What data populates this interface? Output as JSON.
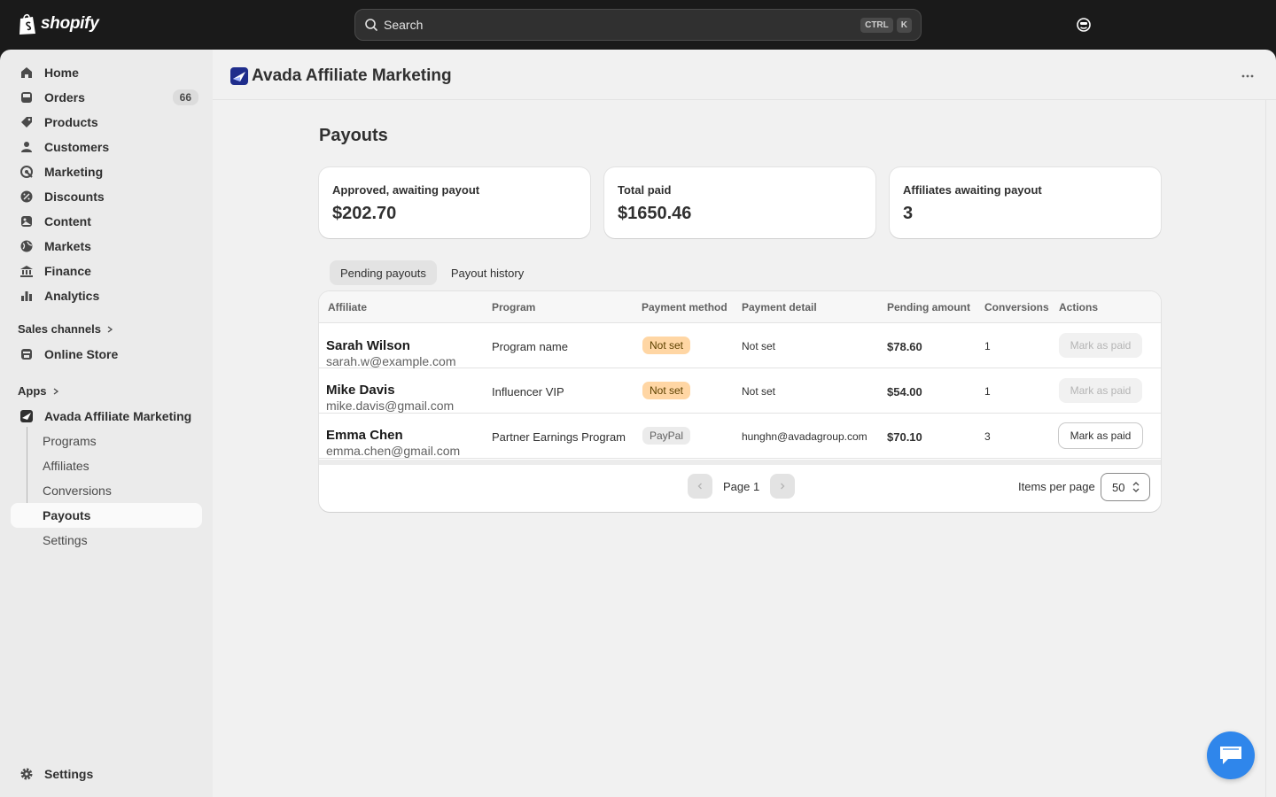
{
  "topbar": {
    "brand": "shopify",
    "search_placeholder": "Search",
    "shortcut_keys": [
      "CTRL",
      "K"
    ]
  },
  "sidebar": {
    "items": [
      {
        "label": "Home",
        "icon": "home-icon"
      },
      {
        "label": "Orders",
        "icon": "inbox-icon",
        "badge": "66"
      },
      {
        "label": "Products",
        "icon": "tag-icon"
      },
      {
        "label": "Customers",
        "icon": "person-icon"
      },
      {
        "label": "Marketing",
        "icon": "target-icon"
      },
      {
        "label": "Discounts",
        "icon": "discount-icon"
      },
      {
        "label": "Content",
        "icon": "content-icon"
      },
      {
        "label": "Markets",
        "icon": "globe-icon"
      },
      {
        "label": "Finance",
        "icon": "bank-icon"
      },
      {
        "label": "Analytics",
        "icon": "bar-chart-icon"
      }
    ],
    "sales_channels_label": "Sales channels",
    "online_store_label": "Online Store",
    "apps_label": "Apps",
    "app_label": "Avada Affiliate Marketing",
    "app_subitems": [
      "Programs",
      "Affiliates",
      "Conversions",
      "Payouts",
      "Settings"
    ],
    "active_subitem": "Payouts",
    "settings_label": "Settings"
  },
  "app": {
    "title": "Avada Affiliate Marketing"
  },
  "page": {
    "title": "Payouts",
    "stats": [
      {
        "label": "Approved, awaiting payout",
        "value": "$202.70"
      },
      {
        "label": "Total paid",
        "value": "$1650.46"
      },
      {
        "label": "Affiliates awaiting payout",
        "value": "3"
      }
    ],
    "tabs": [
      {
        "label": "Pending payouts",
        "active": true
      },
      {
        "label": "Payout history",
        "active": false
      }
    ],
    "table": {
      "columns": [
        "Affiliate",
        "Program",
        "Payment method",
        "Payment detail",
        "Pending amount",
        "Conversions",
        "Actions"
      ],
      "rows": [
        {
          "name": "Sarah Wilson",
          "email": "sarah.w@example.com",
          "program": "Program name",
          "method": "Not set",
          "method_style": "warn",
          "detail": "Not set",
          "amount": "$78.60",
          "conversions": "1",
          "action": "Mark as paid",
          "action_enabled": false
        },
        {
          "name": "Mike Davis",
          "email": "mike.davis@gmail.com",
          "program": "Influencer VIP",
          "method": "Not set",
          "method_style": "warn",
          "detail": "Not set",
          "amount": "$54.00",
          "conversions": "1",
          "action": "Mark as paid",
          "action_enabled": false
        },
        {
          "name": "Emma Chen",
          "email": "emma.chen@gmail.com",
          "program": "Partner Earnings Program",
          "method": "PayPal",
          "method_style": "neutral",
          "detail": "hunghn@avadagroup.com",
          "amount": "$70.10",
          "conversions": "3",
          "action": "Mark as paid",
          "action_enabled": true
        }
      ]
    },
    "pagination": {
      "page_label": "Page 1",
      "items_per_page_label": "Items per page",
      "items_per_page_value": "50"
    }
  },
  "colors": {
    "topbar_bg": "#1a1a1a",
    "warn_badge": "#ffd6a4",
    "chat_button": "#2f86eb"
  }
}
